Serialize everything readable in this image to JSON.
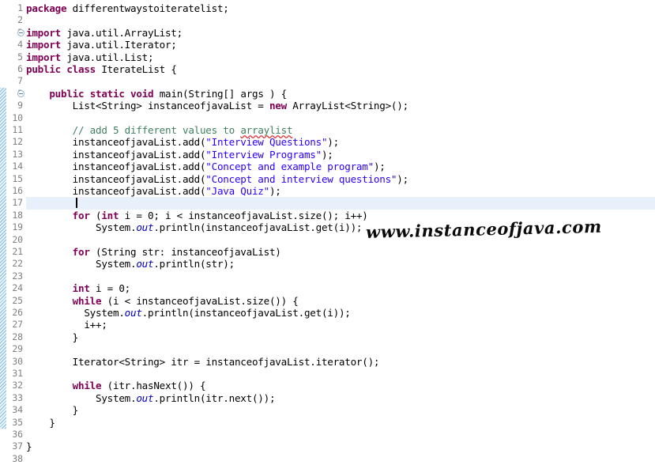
{
  "editor": {
    "kind": "java-source-editor",
    "current_line_number": 17,
    "first_visible_line": 1,
    "last_visible_line": 38,
    "colors": {
      "background": "#ffffff",
      "keyword": "#7f0055",
      "string": "#2a00ff",
      "comment": "#3f7f5f",
      "field": "#0000c0",
      "line_number": "#808080",
      "current_line_highlight": "#e8f0fb",
      "change_bar": "#7fb8dd",
      "spell_error_underline": "#e03030"
    }
  },
  "gutter": {
    "line_numbers": [
      "1",
      "2",
      "3",
      "4",
      "5",
      "6",
      "7",
      "8",
      "9",
      "10",
      "11",
      "12",
      "13",
      "14",
      "15",
      "16",
      "17",
      "18",
      "19",
      "20",
      "21",
      "22",
      "23",
      "24",
      "25",
      "26",
      "27",
      "28",
      "29",
      "30",
      "31",
      "32",
      "33",
      "34",
      "35",
      "36",
      "37",
      "38"
    ],
    "fold_markers": [
      3,
      8
    ],
    "change_bar_start_line": 8,
    "change_bar_end_line": 35
  },
  "code": {
    "language": "Java",
    "lines": [
      {
        "n": 1,
        "tokens": [
          {
            "t": "kw",
            "v": "package"
          },
          {
            "t": "plain",
            "v": " differentwaystoiteratelist;"
          }
        ]
      },
      {
        "n": 2,
        "tokens": []
      },
      {
        "n": 3,
        "tokens": [
          {
            "t": "kw",
            "v": "import"
          },
          {
            "t": "plain",
            "v": " java.util.ArrayList;"
          }
        ]
      },
      {
        "n": 4,
        "tokens": [
          {
            "t": "kw",
            "v": "import"
          },
          {
            "t": "plain",
            "v": " java.util.Iterator;"
          }
        ]
      },
      {
        "n": 5,
        "tokens": [
          {
            "t": "kw",
            "v": "import"
          },
          {
            "t": "plain",
            "v": " java.util.List;"
          }
        ]
      },
      {
        "n": 6,
        "tokens": [
          {
            "t": "kw",
            "v": "public"
          },
          {
            "t": "plain",
            "v": " "
          },
          {
            "t": "kw",
            "v": "class"
          },
          {
            "t": "plain",
            "v": " IterateList {"
          }
        ]
      },
      {
        "n": 7,
        "tokens": []
      },
      {
        "n": 8,
        "tokens": [
          {
            "t": "plain",
            "v": "    "
          },
          {
            "t": "kw",
            "v": "public"
          },
          {
            "t": "plain",
            "v": " "
          },
          {
            "t": "kw",
            "v": "static"
          },
          {
            "t": "plain",
            "v": " "
          },
          {
            "t": "kw",
            "v": "void"
          },
          {
            "t": "plain",
            "v": " main(String[] args ) {"
          }
        ]
      },
      {
        "n": 9,
        "tokens": [
          {
            "t": "plain",
            "v": "        List<String> instanceofjavaList = "
          },
          {
            "t": "kw",
            "v": "new"
          },
          {
            "t": "plain",
            "v": " ArrayList<String>();"
          }
        ]
      },
      {
        "n": 10,
        "tokens": []
      },
      {
        "n": 11,
        "tokens": [
          {
            "t": "plain",
            "v": "        "
          },
          {
            "t": "cmt",
            "v": "// add 5 different values to "
          },
          {
            "t": "cmtsq",
            "v": "arraylist"
          }
        ]
      },
      {
        "n": 12,
        "tokens": [
          {
            "t": "plain",
            "v": "        instanceofjavaList.add("
          },
          {
            "t": "str",
            "v": "\"Interview Questions\""
          },
          {
            "t": "plain",
            "v": ");"
          }
        ]
      },
      {
        "n": 13,
        "tokens": [
          {
            "t": "plain",
            "v": "        instanceofjavaList.add("
          },
          {
            "t": "str",
            "v": "\"Interview Programs\""
          },
          {
            "t": "plain",
            "v": ");"
          }
        ]
      },
      {
        "n": 14,
        "tokens": [
          {
            "t": "plain",
            "v": "        instanceofjavaList.add("
          },
          {
            "t": "str",
            "v": "\"Concept and example program\""
          },
          {
            "t": "plain",
            "v": ");"
          }
        ]
      },
      {
        "n": 15,
        "tokens": [
          {
            "t": "plain",
            "v": "        instanceofjavaList.add("
          },
          {
            "t": "str",
            "v": "\"Concept and interview questions\""
          },
          {
            "t": "plain",
            "v": ");"
          }
        ]
      },
      {
        "n": 16,
        "tokens": [
          {
            "t": "plain",
            "v": "        instanceofjavaList.add("
          },
          {
            "t": "str",
            "v": "\"Java Quiz\""
          },
          {
            "t": "plain",
            "v": ");"
          }
        ]
      },
      {
        "n": 17,
        "tokens": []
      },
      {
        "n": 18,
        "tokens": [
          {
            "t": "plain",
            "v": "        "
          },
          {
            "t": "kw",
            "v": "for"
          },
          {
            "t": "plain",
            "v": " ("
          },
          {
            "t": "kw",
            "v": "int"
          },
          {
            "t": "plain",
            "v": " i = 0; i < instanceofjavaList.size(); i++)"
          }
        ]
      },
      {
        "n": 19,
        "tokens": [
          {
            "t": "plain",
            "v": "            System."
          },
          {
            "t": "fld",
            "v": "out"
          },
          {
            "t": "plain",
            "v": ".println(instanceofjavaList.get(i));"
          }
        ]
      },
      {
        "n": 20,
        "tokens": []
      },
      {
        "n": 21,
        "tokens": [
          {
            "t": "plain",
            "v": "        "
          },
          {
            "t": "kw",
            "v": "for"
          },
          {
            "t": "plain",
            "v": " (String str: instanceofjavaList)"
          }
        ]
      },
      {
        "n": 22,
        "tokens": [
          {
            "t": "plain",
            "v": "            System."
          },
          {
            "t": "fld",
            "v": "out"
          },
          {
            "t": "plain",
            "v": ".println(str);"
          }
        ]
      },
      {
        "n": 23,
        "tokens": []
      },
      {
        "n": 24,
        "tokens": [
          {
            "t": "plain",
            "v": "        "
          },
          {
            "t": "kw",
            "v": "int"
          },
          {
            "t": "plain",
            "v": " i = 0;"
          }
        ]
      },
      {
        "n": 25,
        "tokens": [
          {
            "t": "plain",
            "v": "        "
          },
          {
            "t": "kw",
            "v": "while"
          },
          {
            "t": "plain",
            "v": " (i < instanceofjavaList.size()) {"
          }
        ]
      },
      {
        "n": 26,
        "tokens": [
          {
            "t": "plain",
            "v": "          System."
          },
          {
            "t": "fld",
            "v": "out"
          },
          {
            "t": "plain",
            "v": ".println(instanceofjavaList.get(i));"
          }
        ]
      },
      {
        "n": 27,
        "tokens": [
          {
            "t": "plain",
            "v": "          i++;"
          }
        ]
      },
      {
        "n": 28,
        "tokens": [
          {
            "t": "plain",
            "v": "        }"
          }
        ]
      },
      {
        "n": 29,
        "tokens": []
      },
      {
        "n": 30,
        "tokens": [
          {
            "t": "plain",
            "v": "        Iterator<String> itr = instanceofjavaList.iterator();"
          }
        ]
      },
      {
        "n": 31,
        "tokens": []
      },
      {
        "n": 32,
        "tokens": [
          {
            "t": "plain",
            "v": "        "
          },
          {
            "t": "kw",
            "v": "while"
          },
          {
            "t": "plain",
            "v": " (itr.hasNext()) {"
          }
        ]
      },
      {
        "n": 33,
        "tokens": [
          {
            "t": "plain",
            "v": "            System."
          },
          {
            "t": "fld",
            "v": "out"
          },
          {
            "t": "plain",
            "v": ".println(itr.next());"
          }
        ]
      },
      {
        "n": 34,
        "tokens": [
          {
            "t": "plain",
            "v": "        }"
          }
        ]
      },
      {
        "n": 35,
        "tokens": [
          {
            "t": "plain",
            "v": "    }"
          }
        ]
      },
      {
        "n": 36,
        "tokens": []
      },
      {
        "n": 37,
        "tokens": [
          {
            "t": "plain",
            "v": "}"
          }
        ]
      },
      {
        "n": 38,
        "tokens": []
      }
    ]
  },
  "watermark": {
    "text": "www.instanceofjava.com"
  }
}
